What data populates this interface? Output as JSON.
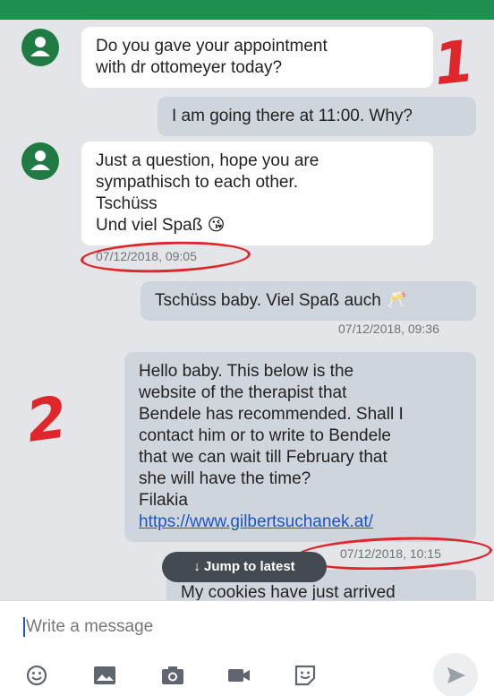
{
  "messages": [
    {
      "side": "incoming",
      "lines": [
        "Do you gave your appointment",
        "with dr ottomeyer today?"
      ]
    },
    {
      "side": "outgoing",
      "lines": [
        "I am going there at 11:00. Why?"
      ]
    },
    {
      "side": "incoming",
      "lines": [
        "Just a question, hope you are",
        "sympathisch to each other.",
        "Tschüss",
        "Und viel Spaß 😘"
      ],
      "time": "07/12/2018, 09:05"
    },
    {
      "side": "outgoing",
      "lines": [
        "Tschüss baby. Viel Spaß auch 🥂"
      ],
      "time": "07/12/2018, 09:36"
    },
    {
      "side": "outgoing",
      "lines": [
        "Hello baby. This below is the",
        "website of the therapist that",
        "Bendele has recommended. Shall I",
        "contact him or to write to Bendele",
        "that we can wait till February that",
        "she will have the time?",
        "Filakia"
      ],
      "link": "https://www.gilbertsuchanek.at/",
      "time": "07/12/2018, 10:15"
    },
    {
      "side": "outgoing",
      "lines": [
        "My cookies have just arrived"
      ]
    }
  ],
  "annotations": {
    "mark1": "1",
    "mark2": "2"
  },
  "jump_label": "↓ Jump to latest",
  "composer": {
    "placeholder": "Write a message"
  },
  "icons": [
    "emoji-icon",
    "image-icon",
    "camera-icon",
    "video-icon",
    "sticker-icon",
    "send-icon"
  ],
  "colors": {
    "header": "#1f8f4e",
    "avatar": "#1f7a43",
    "annotation": "#e0262b",
    "link": "#1a56c4"
  }
}
